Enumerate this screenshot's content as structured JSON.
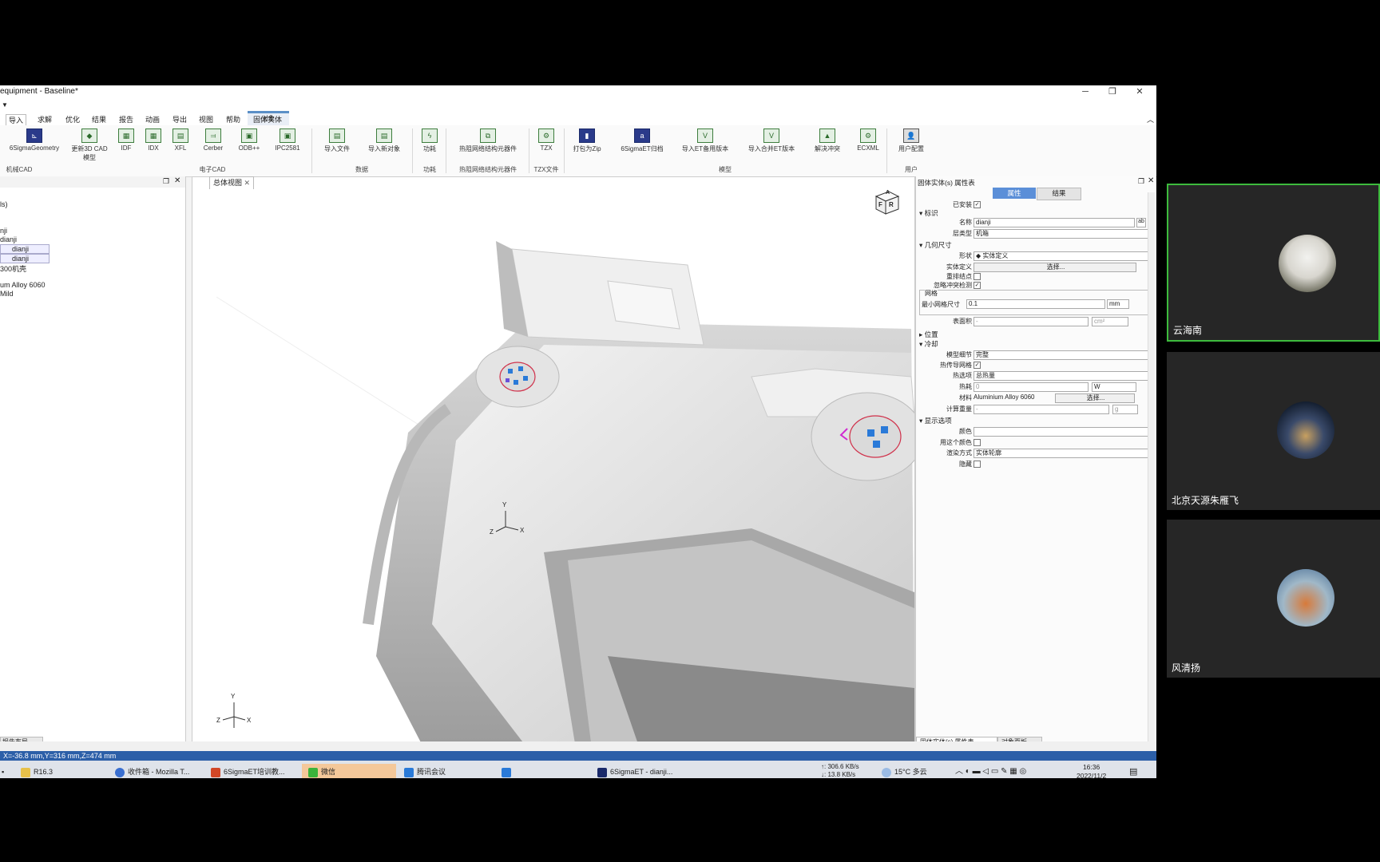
{
  "window": {
    "title": "equipment - Baseline*",
    "controls": [
      "─",
      "❐",
      "✕"
    ]
  },
  "menu": {
    "context_tab": "对象",
    "items": [
      "导入",
      "求解",
      "优化",
      "结果",
      "报告",
      "动画",
      "导出",
      "视图",
      "帮助",
      "固体实体"
    ]
  },
  "ribbon": {
    "buttons": [
      {
        "label": "6SigmaGeometry",
        "icon": "geometry-icon"
      },
      {
        "label": "更新3D CAD模型",
        "icon": "cad-update-icon"
      },
      {
        "label": "IDF",
        "icon": "idf-icon"
      },
      {
        "label": "IDX",
        "icon": "idx-icon"
      },
      {
        "label": "XFL",
        "icon": "xfl-icon"
      },
      {
        "label": "Cerber",
        "icon": "cerber-icon"
      },
      {
        "label": "ODB++",
        "icon": "odb-icon"
      },
      {
        "label": "IPC2581",
        "icon": "ipc-icon"
      },
      {
        "label": "导入文件",
        "icon": "import-file-icon"
      },
      {
        "label": "导入新对象",
        "icon": "import-object-icon"
      },
      {
        "label": "功耗",
        "icon": "power-icon"
      },
      {
        "label": "热阻网络结构元器件",
        "icon": "thermal-network-icon"
      },
      {
        "label": "TZX",
        "icon": "tzx-icon"
      },
      {
        "label": "打包为Zip",
        "icon": "zip-icon"
      },
      {
        "label": "6SigmaET归档",
        "icon": "archive-icon"
      },
      {
        "label": "导入ET备用版本",
        "icon": "import-version-icon"
      },
      {
        "label": "导入合并ET版本",
        "icon": "merge-version-icon"
      },
      {
        "label": "解决冲突",
        "icon": "conflict-icon"
      },
      {
        "label": "ECXML",
        "icon": "ecxml-icon"
      },
      {
        "label": "用户配置",
        "icon": "user-config-icon"
      }
    ],
    "groups": [
      "机械CAD",
      "电子CAD",
      "数据",
      "功耗",
      "热阻网络结构元器件",
      "TZX文件",
      "模型",
      "用户"
    ]
  },
  "left_panel": {
    "lines": [
      "ls)",
      "nji",
      "dianji",
      "dianji",
      "dianji",
      "300机壳",
      "um Alloy 6060",
      "Mild"
    ],
    "bottom_tab": "报告布局"
  },
  "viewport": {
    "tab_label": "总体视图",
    "nav_cube_faces": [
      "A",
      "R",
      "F"
    ],
    "axes": [
      "Y",
      "Z",
      "X"
    ]
  },
  "properties": {
    "panel_title": "固体实体(s) 属性表",
    "tabs": [
      "属性",
      "结果"
    ],
    "installed_label": "已安装",
    "sections": {
      "identity": "标识",
      "geometry": "几何尺寸",
      "mesh": "网格",
      "position": "位置",
      "cooling": "冷却",
      "display": "显示选项"
    },
    "fields": {
      "name_label": "名称",
      "name_value": "dianji",
      "layer_label": "层类型",
      "layer_value": "机箱",
      "shape_label": "形状",
      "shape_value": "◆ 实体定义",
      "solid_def_label": "实体定义",
      "solid_def_button": "选择...",
      "overlap_label": "重排结点",
      "ignore_label": "忽略冲突检测",
      "min_grid_label": "最小网格尺寸",
      "min_grid_value": "0.1",
      "min_grid_unit": "mm",
      "area_label": "表面积",
      "area_value": "-",
      "area_unit": "cm²",
      "model_label": "模型细节",
      "model_value": "完整",
      "conduct_label": "热传导网格",
      "heat_option_label": "热选项",
      "heat_option_value": "总热量",
      "power_label": "热耗",
      "power_value": "0",
      "power_unit": "W",
      "material_label": "材料",
      "material_value": "Aluminium Alloy 6060",
      "material_button": "选择...",
      "weight_label": "计算重量",
      "weight_value": "-",
      "weight_unit": "g",
      "color_label": "颜色",
      "use_color_label": "用这个颜色",
      "render_label": "渲染方式",
      "render_value": "实体轮廓",
      "hide_label": "隐藏"
    },
    "bottom_tabs": [
      "固体实体(s) 属性表",
      "对象面板"
    ]
  },
  "status": {
    "coords": "X=-36.8 mm,Y=316 mm,Z=474 mm"
  },
  "taskbar": {
    "items": [
      "R16.3",
      "收件箱 - Mozilla T...",
      "6SigmaET培训教...",
      "微信",
      "腾讯会议",
      "",
      "6SigmaET - dianji..."
    ],
    "net_up": "↑: 306.6 KB/s",
    "net_down": "↓: 13.8 KB/s",
    "weather": "15°C 多云",
    "time": "16:36",
    "date": "2022/11/2"
  },
  "participants": [
    {
      "name": "云海南"
    },
    {
      "name": "北京天源朱雁飞"
    },
    {
      "name": "风清扬"
    }
  ],
  "colors": {
    "accent": "#2c5fa8",
    "active_speaker": "#3dbb3d",
    "taskbar_active": "#f4c89a"
  }
}
